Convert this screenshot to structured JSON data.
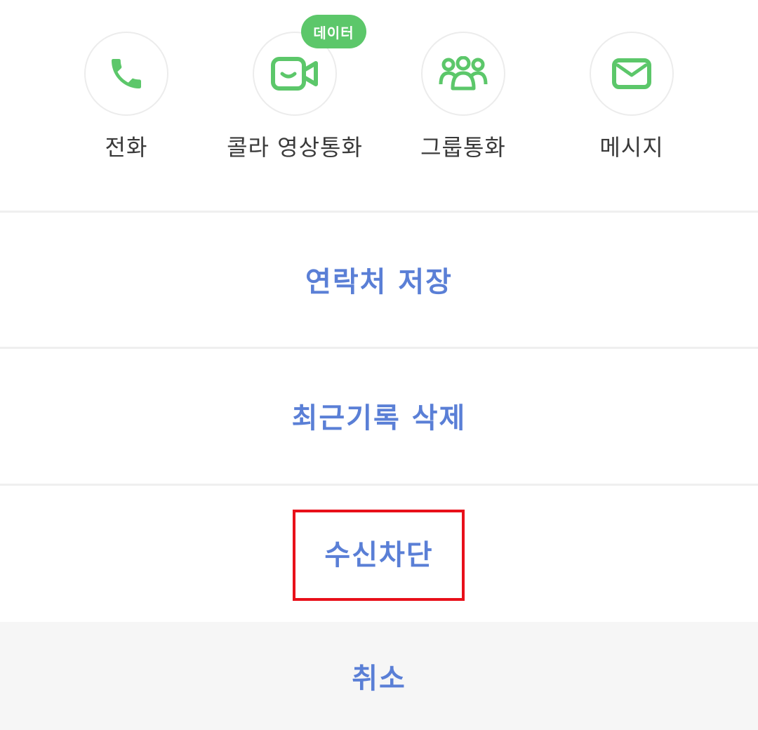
{
  "actions": [
    {
      "label": "전화",
      "icon": "phone-icon"
    },
    {
      "label": "콜라 영상통화",
      "icon": "video-call-icon",
      "badge": "데이터"
    },
    {
      "label": "그룹통화",
      "icon": "group-icon"
    },
    {
      "label": "메시지",
      "icon": "message-icon"
    }
  ],
  "menu": {
    "save_contact": "연락처 저장",
    "delete_recent": "최근기록 삭제",
    "block_calls": "수신차단",
    "cancel": "취소"
  },
  "colors": {
    "accent_green": "#5cc76a",
    "menu_text": "#5a7fd6",
    "highlight": "#e8101a"
  }
}
